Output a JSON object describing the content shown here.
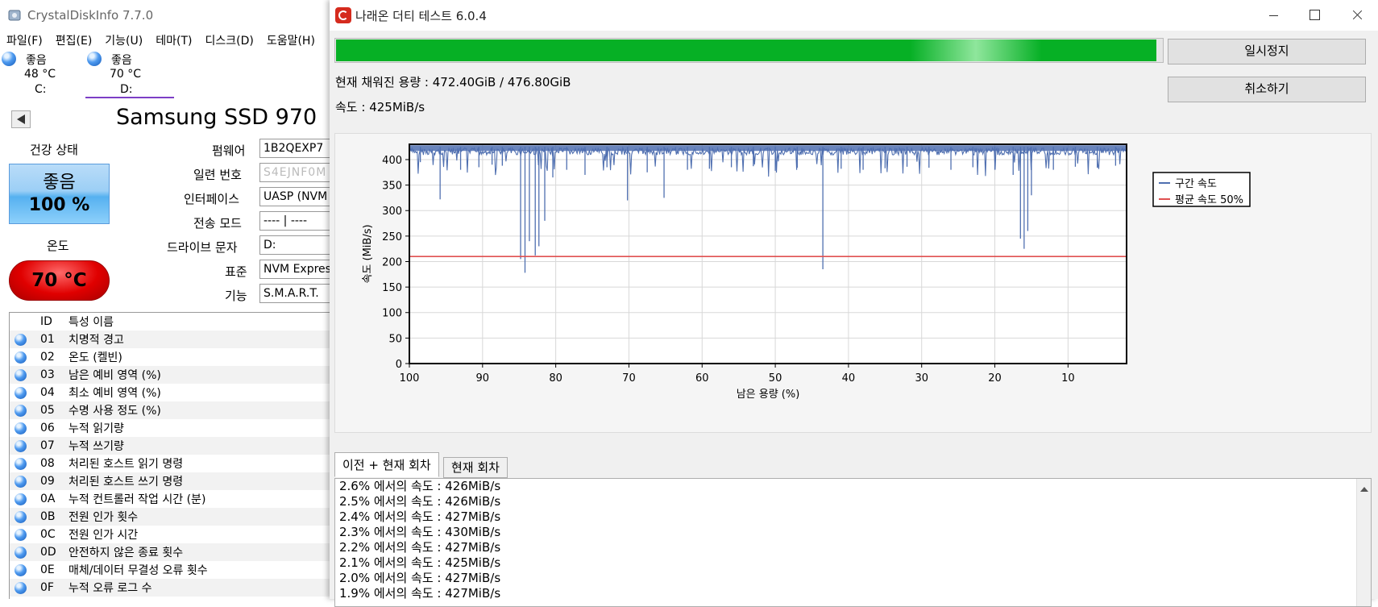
{
  "cdi": {
    "title": "CrystalDiskInfo 7.7.0",
    "menu": [
      "파일(F)",
      "편집(E)",
      "기능(U)",
      "테마(T)",
      "디스크(D)",
      "도움말(H)"
    ],
    "drives": [
      {
        "status": "좋음",
        "temp": "48 °C",
        "letter": "C:"
      },
      {
        "status": "좋음",
        "temp": "70 °C",
        "letter": "D:"
      }
    ],
    "model": "Samsung SSD 970",
    "health_label": "건강 상태",
    "health_status": "좋음",
    "health_percent": "100 %",
    "temp_label": "온도",
    "temp_value": "70 °C",
    "fields": [
      {
        "label": "펌웨어",
        "value": "1B2QEXP7"
      },
      {
        "label": "일련 번호",
        "value": "S4EJNF0M",
        "blurred": true
      },
      {
        "label": "인터페이스",
        "value": "UASP (NVM"
      },
      {
        "label": "전송 모드",
        "value": "---- | ----"
      },
      {
        "label": "드라이브 문자",
        "value": "D:"
      },
      {
        "label": "표준",
        "value": "NVM Expres"
      },
      {
        "label": "기능",
        "value": "S.M.A.R.T."
      }
    ],
    "smart_header": {
      "id": "ID",
      "name": "특성 이름"
    },
    "smart_rows": [
      {
        "id": "01",
        "name": "치명적 경고"
      },
      {
        "id": "02",
        "name": "온도 (켈빈)"
      },
      {
        "id": "03",
        "name": "남은 예비 영역 (%)"
      },
      {
        "id": "04",
        "name": "최소 예비 영역 (%)"
      },
      {
        "id": "05",
        "name": "수명 사용 정도 (%)"
      },
      {
        "id": "06",
        "name": "누적 읽기량"
      },
      {
        "id": "07",
        "name": "누적 쓰기량"
      },
      {
        "id": "08",
        "name": "처리된 호스트 읽기 명령"
      },
      {
        "id": "09",
        "name": "처리된 호스트 쓰기 명령"
      },
      {
        "id": "0A",
        "name": "누적 컨트롤러 작업 시간 (분)"
      },
      {
        "id": "0B",
        "name": "전원 인가 횟수"
      },
      {
        "id": "0C",
        "name": "전원 인가 시간"
      },
      {
        "id": "0D",
        "name": "안전하지 않은 종료 횟수"
      },
      {
        "id": "0E",
        "name": "매체/데이터 무결성 오류 횟수"
      },
      {
        "id": "0F",
        "name": "누적 오류 로그 수"
      }
    ]
  },
  "nt": {
    "title": "나래온 더티 테스트 6.0.4",
    "progress_fraction": 0.9908,
    "filled_text": "현재 채워진 용량 : 472.40GiB / 476.80GiB",
    "speed_text": "속도 : 425MiB/s",
    "pause_button": "일시정지",
    "cancel_button": "취소하기",
    "tabs": [
      "이전 + 현재 회차",
      "현재 회차"
    ],
    "log": [
      "2.6% 에서의 속도 : 426MiB/s",
      "2.5% 에서의 속도 : 426MiB/s",
      "2.4% 에서의 속도 : 427MiB/s",
      "2.3% 에서의 속도 : 430MiB/s",
      "2.2% 에서의 속도 : 427MiB/s",
      "2.1% 에서의 속도 : 425MiB/s",
      "2.0% 에서의 속도 : 427MiB/s",
      "1.9% 에서의 속도 : 427MiB/s"
    ]
  },
  "chart_data": {
    "type": "line",
    "xlabel": "남은 용량 (%)",
    "ylabel": "속도 (MiB/s)",
    "xlim": [
      100,
      2
    ],
    "ylim": [
      0,
      430
    ],
    "x_ticks": [
      100,
      90,
      80,
      70,
      60,
      50,
      40,
      30,
      20,
      10
    ],
    "y_ticks": [
      0,
      50,
      100,
      150,
      200,
      250,
      300,
      350,
      400
    ],
    "grid": true,
    "legend_position": "right",
    "baseline": 425,
    "dips": [
      {
        "x": 98.5,
        "y": 395
      },
      {
        "x": 95.8,
        "y": 322
      },
      {
        "x": 93.0,
        "y": 380
      },
      {
        "x": 90.5,
        "y": 385
      },
      {
        "x": 88.7,
        "y": 390
      },
      {
        "x": 87.3,
        "y": 388
      },
      {
        "x": 84.8,
        "y": 205
      },
      {
        "x": 84.2,
        "y": 178
      },
      {
        "x": 83.6,
        "y": 240
      },
      {
        "x": 82.8,
        "y": 212
      },
      {
        "x": 82.3,
        "y": 230
      },
      {
        "x": 81.5,
        "y": 280
      },
      {
        "x": 80.4,
        "y": 365
      },
      {
        "x": 78.5,
        "y": 380
      },
      {
        "x": 76.0,
        "y": 370
      },
      {
        "x": 73.0,
        "y": 385
      },
      {
        "x": 70.2,
        "y": 320
      },
      {
        "x": 67.5,
        "y": 375
      },
      {
        "x": 65.2,
        "y": 325
      },
      {
        "x": 62.0,
        "y": 380
      },
      {
        "x": 59.0,
        "y": 382
      },
      {
        "x": 56.0,
        "y": 385
      },
      {
        "x": 53.0,
        "y": 387
      },
      {
        "x": 50.0,
        "y": 378
      },
      {
        "x": 47.0,
        "y": 384
      },
      {
        "x": 43.5,
        "y": 185
      },
      {
        "x": 41.0,
        "y": 382
      },
      {
        "x": 38.0,
        "y": 380
      },
      {
        "x": 35.0,
        "y": 383
      },
      {
        "x": 32.0,
        "y": 386
      },
      {
        "x": 29.0,
        "y": 384
      },
      {
        "x": 26.0,
        "y": 380
      },
      {
        "x": 23.0,
        "y": 385
      },
      {
        "x": 20.0,
        "y": 380
      },
      {
        "x": 17.5,
        "y": 370
      },
      {
        "x": 16.5,
        "y": 245
      },
      {
        "x": 16.0,
        "y": 225
      },
      {
        "x": 15.5,
        "y": 260
      },
      {
        "x": 15.0,
        "y": 330
      },
      {
        "x": 12.0,
        "y": 380
      },
      {
        "x": 9.0,
        "y": 386
      },
      {
        "x": 6.0,
        "y": 384
      },
      {
        "x": 3.5,
        "y": 388
      }
    ],
    "series": [
      {
        "name": "구간 속도",
        "color": "#4f6fb0"
      },
      {
        "name": "평균 속도 50%",
        "color": "#e05050",
        "value": 210
      }
    ]
  }
}
